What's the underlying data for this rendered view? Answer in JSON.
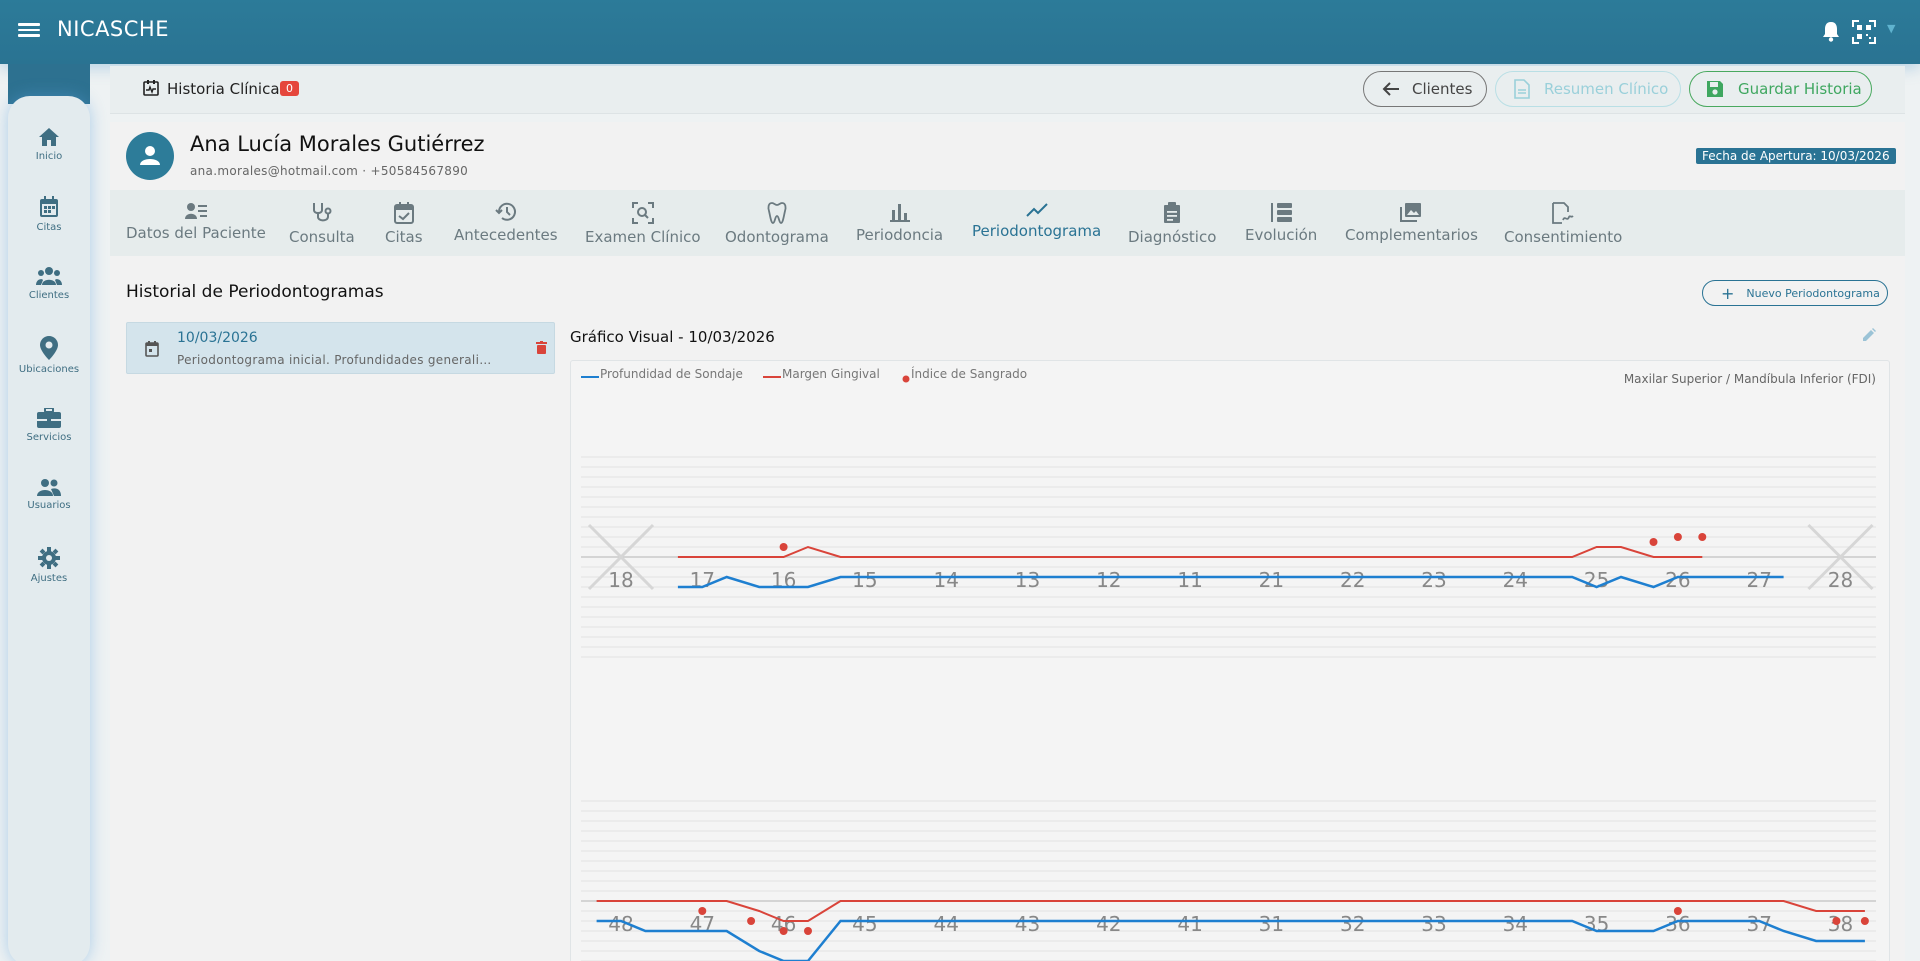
{
  "app": {
    "title": "NICASCHE"
  },
  "sidebar": {
    "items": [
      {
        "label": "Inicio",
        "icon": "home-icon"
      },
      {
        "label": "Citas",
        "icon": "calendar-icon"
      },
      {
        "label": "Clientes",
        "icon": "clients-icon"
      },
      {
        "label": "Ubicaciones",
        "icon": "location-pin-icon"
      },
      {
        "label": "Servicios",
        "icon": "briefcase-icon"
      },
      {
        "label": "Usuarios",
        "icon": "users-icon"
      },
      {
        "label": "Ajustes",
        "icon": "gear-icon"
      }
    ]
  },
  "subheader": {
    "title": "Historia Clínica",
    "badge": "0",
    "clients_label": "Clientes",
    "resumen_label": "Resumen Clínico",
    "guardar_label": "Guardar Historia"
  },
  "patient": {
    "name": "Ana Lucía Morales Gutiérrez",
    "contact": "ana.morales@hotmail.com · +50584567890",
    "apertura": "Fecha de Apertura: 10/03/2026"
  },
  "tabs": [
    {
      "label": "Datos del Paciente",
      "icon": "patient-data-icon"
    },
    {
      "label": "Consulta",
      "icon": "stethoscope-icon"
    },
    {
      "label": "Citas",
      "icon": "calendar-check-icon"
    },
    {
      "label": "Antecedentes",
      "icon": "history-icon"
    },
    {
      "label": "Examen Clínico",
      "icon": "scan-search-icon"
    },
    {
      "label": "Odontograma",
      "icon": "tooth-icon"
    },
    {
      "label": "Periodoncia",
      "icon": "bar-chart-icon"
    },
    {
      "label": "Periodontograma",
      "icon": "trend-line-icon",
      "active": true
    },
    {
      "label": "Diagnóstico",
      "icon": "clipboard-icon"
    },
    {
      "label": "Evolución",
      "icon": "timeline-list-icon"
    },
    {
      "label": "Complementarios",
      "icon": "images-icon"
    },
    {
      "label": "Consentimiento",
      "icon": "signature-icon"
    }
  ],
  "history": {
    "title": "Historial de Periodontogramas",
    "new_button": "Nuevo Periodontograma",
    "items": [
      {
        "date": "10/03/2026",
        "description": "Periodontograma inicial. Profundidades generalizadas"
      }
    ]
  },
  "graph": {
    "title": "Gráfico Visual - 10/03/2026",
    "subtitle": "Maxilar Superior / Mandíbula Inferior (FDI)"
  },
  "colors": {
    "primary": "#2a7394",
    "probing": "#1e7fd0",
    "gingival": "#d9443a",
    "bleeding": "#d9443a",
    "save": "#3fa760",
    "badge": "#e5463c"
  },
  "chart_data": {
    "type": "line",
    "legend": [
      "Profundidad de Sondaje",
      "Margen Gingival",
      "Índice de Sangrado"
    ],
    "legend_position": "top-left",
    "upper": {
      "teeth": [
        "18",
        "17",
        "16",
        "15",
        "14",
        "13",
        "12",
        "11",
        "21",
        "22",
        "23",
        "24",
        "25",
        "26",
        "27",
        "28"
      ],
      "missing": [
        "18",
        "28"
      ],
      "probing_depth": [
        null,
        null,
        null,
        3,
        3,
        2,
        3,
        3,
        3,
        2,
        2,
        2,
        2,
        2,
        2,
        2,
        2,
        2,
        2,
        2,
        2,
        2,
        2,
        2,
        2,
        2,
        2,
        2,
        2,
        2,
        2,
        2,
        2,
        2,
        2,
        2,
        2,
        3,
        2,
        3,
        2,
        2,
        2,
        2,
        2,
        null,
        null,
        null
      ],
      "gingival_margin": [
        null,
        null,
        null,
        0,
        0,
        0,
        0,
        0,
        -1,
        0,
        0,
        0,
        0,
        0,
        0,
        0,
        0,
        0,
        0,
        0,
        0,
        0,
        0,
        0,
        0,
        0,
        0,
        0,
        0,
        0,
        0,
        0,
        0,
        0,
        0,
        0,
        0,
        -1,
        -1,
        0,
        0,
        0,
        null,
        null,
        null
      ],
      "bleeding": [
        "16",
        "25",
        "26",
        "26b"
      ]
    },
    "lower": {
      "teeth": [
        "48",
        "47",
        "46",
        "45",
        "44",
        "43",
        "42",
        "41",
        "31",
        "32",
        "33",
        "34",
        "35",
        "36",
        "37",
        "38"
      ],
      "missing": [],
      "probing_depth": [
        2,
        2,
        3,
        3,
        3,
        3,
        5,
        6,
        6,
        2,
        2,
        2,
        2,
        2,
        2,
        2,
        2,
        2,
        2,
        2,
        2,
        2,
        2,
        2,
        2,
        2,
        2,
        2,
        2,
        2,
        2,
        2,
        2,
        2,
        2,
        2,
        2,
        3,
        3,
        3,
        2,
        2,
        2,
        2,
        3,
        4,
        4,
        4
      ],
      "gingival_margin": [
        0,
        0,
        0,
        0,
        0,
        0,
        1,
        2,
        2,
        0,
        0,
        0,
        0,
        0,
        0,
        0,
        0,
        0,
        0,
        0,
        0,
        0,
        0,
        0,
        0,
        0,
        0,
        0,
        0,
        0,
        0,
        0,
        0,
        0,
        0,
        0,
        0,
        0,
        0,
        0,
        0,
        0,
        0,
        0,
        0,
        1,
        1,
        1
      ],
      "bleeding": [
        "47",
        "46a",
        "46b",
        "46c",
        "36",
        "38a",
        "38b"
      ]
    }
  }
}
